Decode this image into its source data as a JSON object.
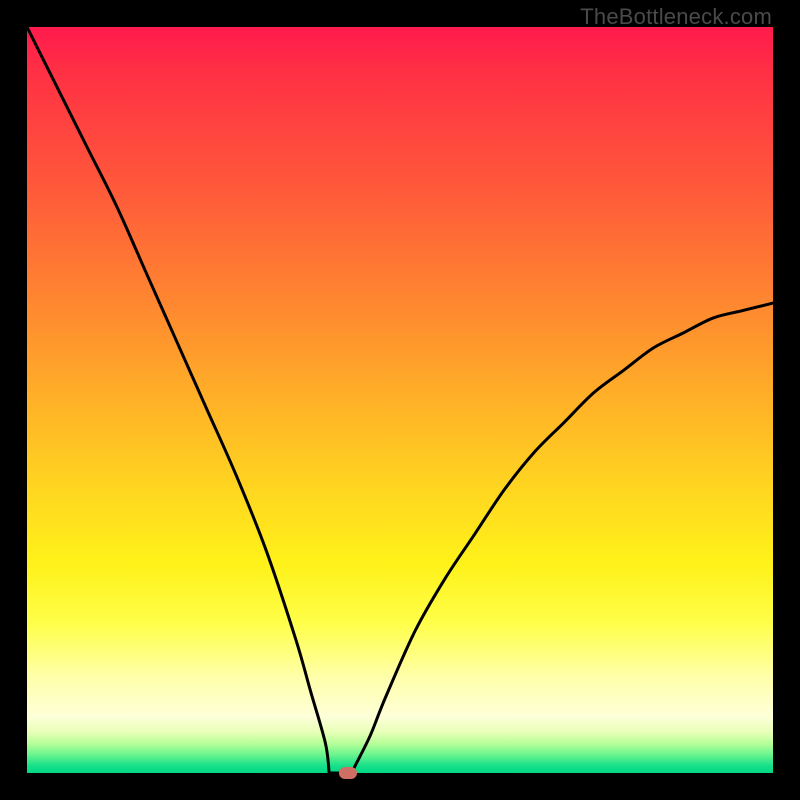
{
  "watermark": "TheBottleneck.com",
  "colors": {
    "frame": "#000000",
    "curve": "#000000",
    "marker": "#cf6f63"
  },
  "chart_data": {
    "type": "line",
    "title": "",
    "xlabel": "",
    "ylabel": "",
    "xlim": [
      0,
      100
    ],
    "ylim": [
      0,
      100
    ],
    "series": [
      {
        "name": "bottleneck-curve",
        "x": [
          0,
          4,
          8,
          12,
          16,
          20,
          24,
          28,
          32,
          36,
          38,
          40,
          41,
          42,
          43,
          44,
          46,
          48,
          52,
          56,
          60,
          64,
          68,
          72,
          76,
          80,
          84,
          88,
          92,
          96,
          100
        ],
        "values": [
          100,
          92,
          84,
          76,
          67,
          58,
          49,
          40,
          30,
          18,
          11,
          4,
          1,
          0,
          0,
          1,
          5,
          10,
          19,
          26,
          32,
          38,
          43,
          47,
          51,
          54,
          57,
          59,
          61,
          62,
          63
        ]
      }
    ],
    "marker": {
      "x": 43,
      "y": 0
    },
    "flat_bottom": {
      "x_start": 40.5,
      "x_end": 43.5,
      "y": 0
    }
  }
}
